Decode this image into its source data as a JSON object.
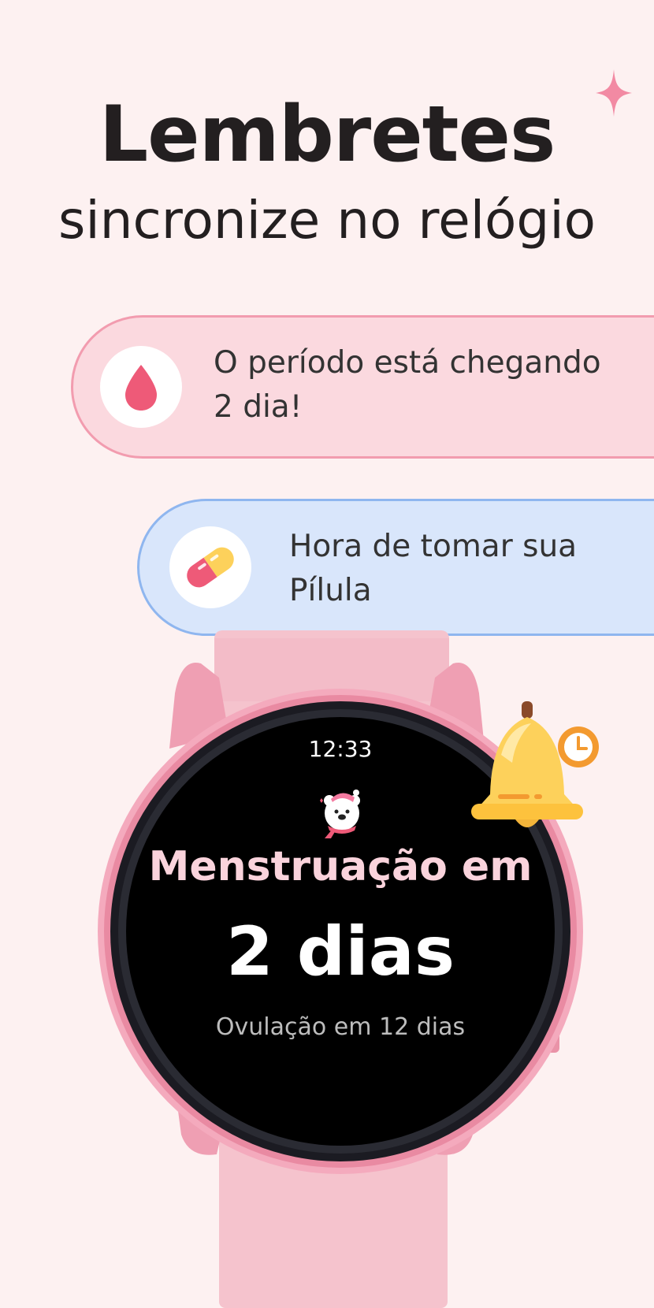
{
  "header": {
    "title": "Lembretes",
    "subtitle": "sincronize no relógio"
  },
  "reminders": [
    {
      "icon": "blood-drop-icon",
      "line1": "O período está chegando",
      "line2": "2 dia!"
    },
    {
      "icon": "pill-capsule-icon",
      "line1": "Hora de tomar sua",
      "line2": "Pílula"
    }
  ],
  "watch": {
    "time": "12:33",
    "mascot": "polar-bear-icon",
    "line1": "Menstruação em",
    "line2": "2 dias",
    "line3": "Ovulação em 12 dias"
  },
  "decorations": {
    "sparkle": "sparkle-icon",
    "bell": "bell-clock-icon"
  },
  "colors": {
    "background": "#fdf1f1",
    "period_pill": "#fbd9df",
    "period_border": "#f29caf",
    "pill_pill": "#d9e6fb",
    "pill_border": "#8fb6ef",
    "drop": "#ee5a78",
    "watch_pink": "#f6b7c7",
    "bell_yellow": "#fdd15b",
    "bell_orange": "#f39a30"
  }
}
